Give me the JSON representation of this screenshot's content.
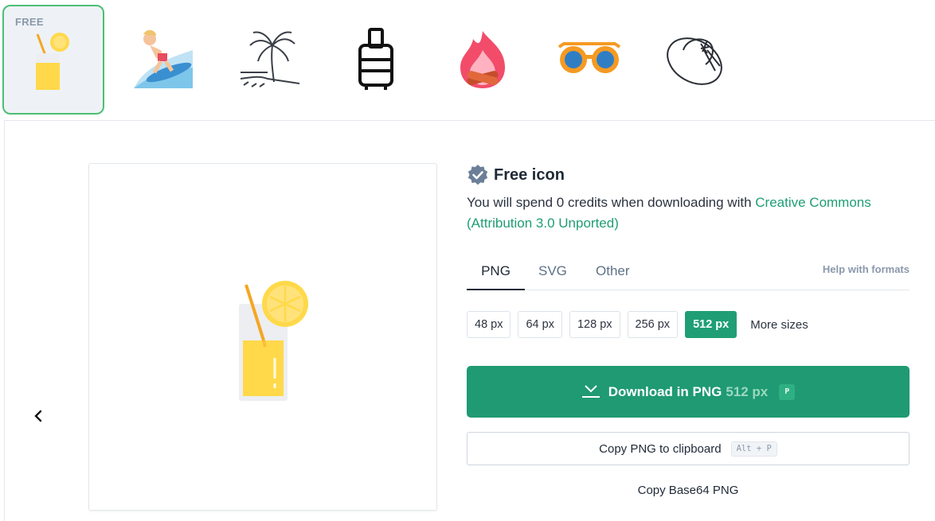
{
  "thumbnails": {
    "selected_tag": "FREE",
    "items": [
      {
        "icon": "lemonade-icon"
      },
      {
        "icon": "surfer-icon"
      },
      {
        "icon": "palm-beach-icon"
      },
      {
        "icon": "suitcase-icon"
      },
      {
        "icon": "bonfire-icon"
      },
      {
        "icon": "sunglasses-icon"
      },
      {
        "icon": "sun-hat-icon"
      }
    ]
  },
  "detail": {
    "badge_title": "Free icon",
    "credits_text": "You will spend 0 credits when downloading with ",
    "license_link": "Creative Commons (Attribution 3.0 Unported)",
    "tabs": [
      "PNG",
      "SVG",
      "Other"
    ],
    "active_tab": "PNG",
    "help_formats": "Help with formats",
    "sizes": [
      "48 px",
      "64 px",
      "128 px",
      "256 px",
      "512 px"
    ],
    "active_size": "512 px",
    "more_sizes": "More sizes",
    "download_label": "Download in PNG",
    "download_size": "512 px",
    "download_key": "P",
    "copy_label": "Copy PNG to clipboard",
    "copy_shortcut": "Alt + P",
    "base64_label": "Copy Base64 PNG"
  },
  "colors": {
    "accent": "#1f9e75",
    "selected_border": "#4cbf73",
    "lemon": "#ffd94a",
    "straw": "#f5a623"
  }
}
